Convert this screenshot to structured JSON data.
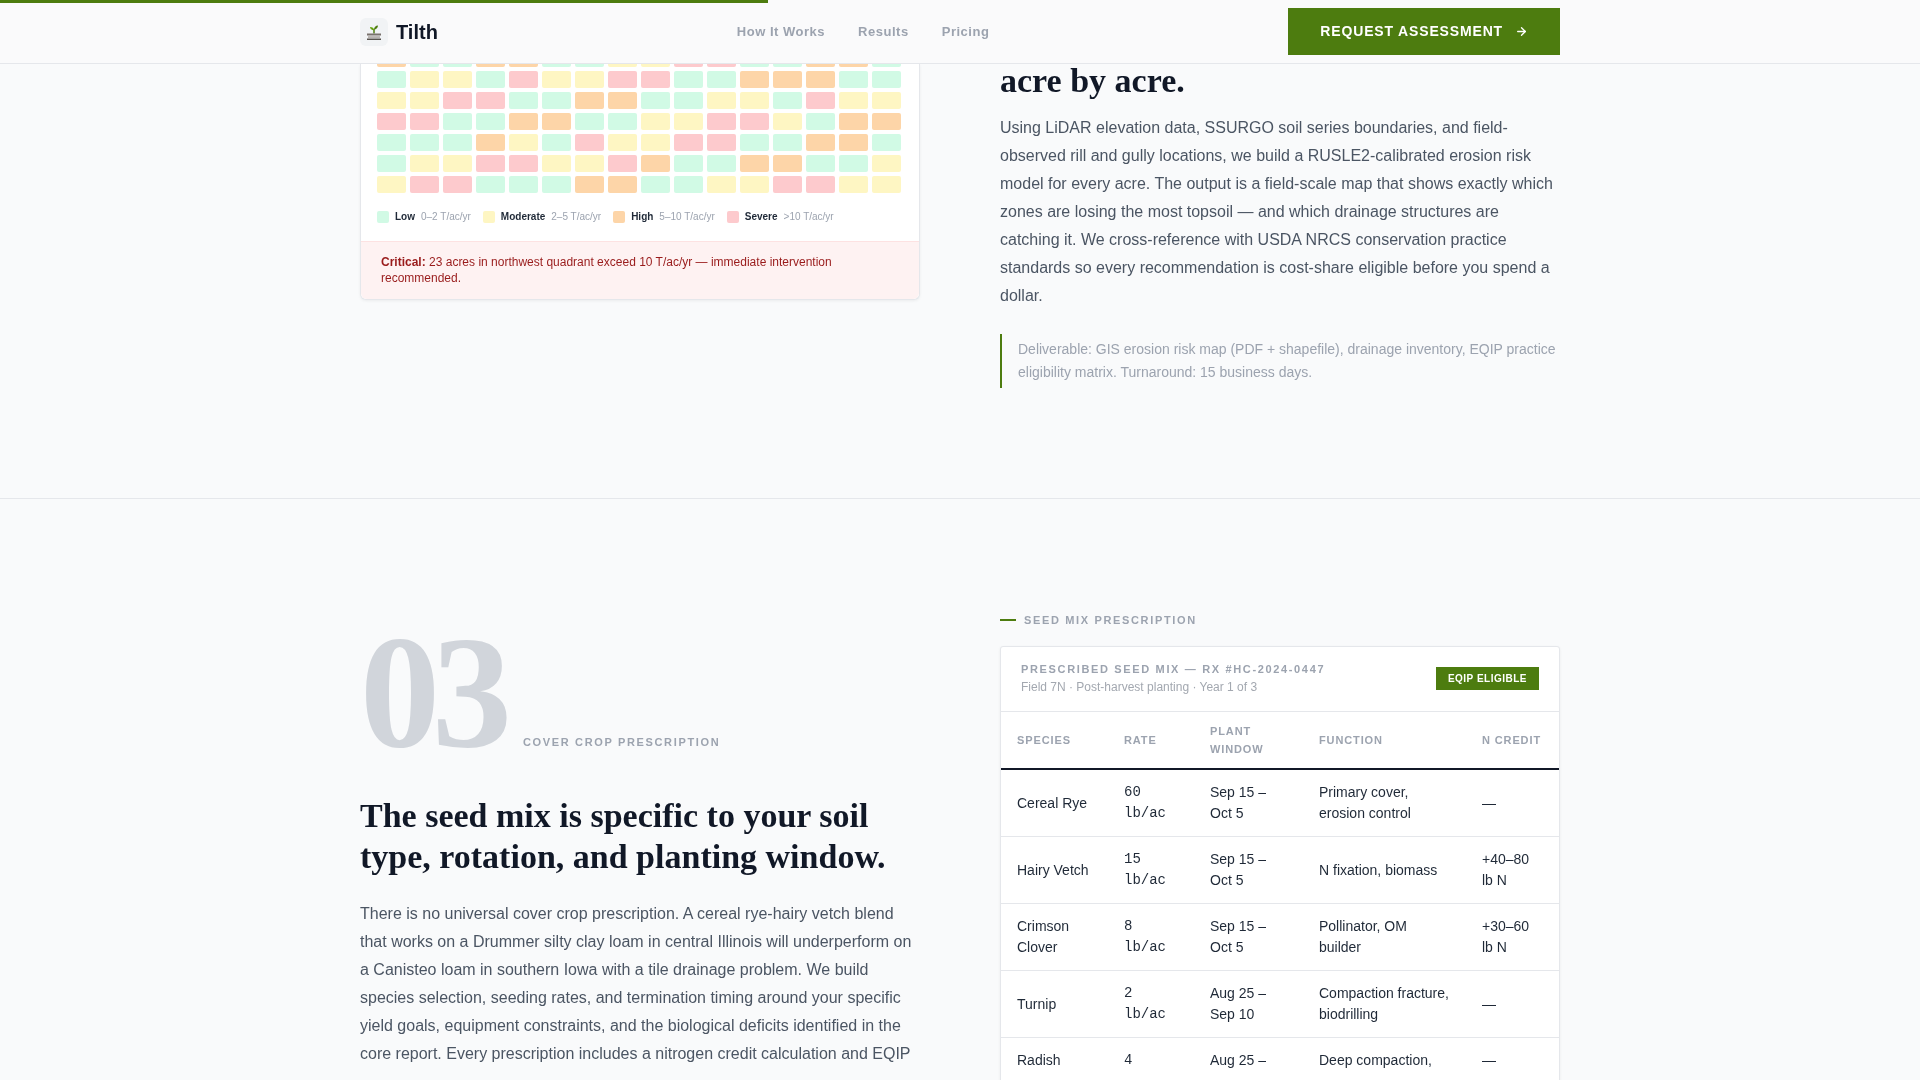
{
  "progress_bar": {
    "level": 0.4
  },
  "header": {
    "brand": "Tilth",
    "nav": [
      {
        "label": "How It Works"
      },
      {
        "label": "Results"
      },
      {
        "label": "Pricing"
      }
    ],
    "cta": "REQUEST ASSESSMENT"
  },
  "erosion_section": {
    "risk_map": {
      "clipped_row": [
        {
          "color": "#fdd5a8"
        },
        {
          "color": "#d1fae5"
        },
        {
          "color": "#d1fae5"
        },
        {
          "color": "#fdd5a8"
        },
        {
          "color": "#fdd5a8"
        },
        {
          "color": "#d1fae5"
        },
        {
          "color": "#d1fae5"
        },
        {
          "color": "#fef6c3"
        },
        {
          "color": "#fef6c3"
        },
        {
          "color": "#fdcacd"
        },
        {
          "color": "#fdcacd"
        },
        {
          "color": "#d1fae5"
        },
        {
          "color": "#d1fae5"
        },
        {
          "color": "#fdd5a8"
        },
        {
          "color": "#fdd5a8"
        },
        {
          "color": "#d1fae5"
        }
      ],
      "rows": [
        [
          {
            "color": "#d1fae5"
          },
          {
            "color": "#fef6c3"
          },
          {
            "color": "#fef6c3"
          },
          {
            "color": "#d1fae5"
          },
          {
            "color": "#fdcacd"
          },
          {
            "color": "#fef6c3"
          },
          {
            "color": "#fef6c3"
          },
          {
            "color": "#fdcacd"
          },
          {
            "color": "#fdcacd"
          },
          {
            "color": "#d1fae5"
          },
          {
            "color": "#d1fae5"
          },
          {
            "color": "#fdd5a8"
          },
          {
            "color": "#fdd5a8"
          },
          {
            "color": "#fdd5a8"
          },
          {
            "color": "#d1fae5"
          },
          {
            "color": "#d1fae5"
          }
        ],
        [
          {
            "color": "#fef6c3"
          },
          {
            "color": "#fef6c3"
          },
          {
            "color": "#fdcacd"
          },
          {
            "color": "#fdcacd"
          },
          {
            "color": "#d1fae5"
          },
          {
            "color": "#d1fae5"
          },
          {
            "color": "#fdd5a8"
          },
          {
            "color": "#fdd5a8"
          },
          {
            "color": "#d1fae5"
          },
          {
            "color": "#d1fae5"
          },
          {
            "color": "#fef6c3"
          },
          {
            "color": "#fef6c3"
          },
          {
            "color": "#d1fae5"
          },
          {
            "color": "#fdcacd"
          },
          {
            "color": "#fef6c3"
          },
          {
            "color": "#fef6c3"
          }
        ],
        [
          {
            "color": "#fdcacd"
          },
          {
            "color": "#fdcacd"
          },
          {
            "color": "#d1fae5"
          },
          {
            "color": "#d1fae5"
          },
          {
            "color": "#fdd5a8"
          },
          {
            "color": "#fdd5a8"
          },
          {
            "color": "#d1fae5"
          },
          {
            "color": "#d1fae5"
          },
          {
            "color": "#fef6c3"
          },
          {
            "color": "#fef6c3"
          },
          {
            "color": "#fdcacd"
          },
          {
            "color": "#fdcacd"
          },
          {
            "color": "#fef6c3"
          },
          {
            "color": "#d1fae5"
          },
          {
            "color": "#fdd5a8"
          },
          {
            "color": "#fdd5a8"
          }
        ],
        [
          {
            "color": "#d1fae5"
          },
          {
            "color": "#d1fae5"
          },
          {
            "color": "#d1fae5"
          },
          {
            "color": "#fdd5a8"
          },
          {
            "color": "#fef6c3"
          },
          {
            "color": "#d1fae5"
          },
          {
            "color": "#fdcacd"
          },
          {
            "color": "#fef6c3"
          },
          {
            "color": "#fef6c3"
          },
          {
            "color": "#fdcacd"
          },
          {
            "color": "#fdcacd"
          },
          {
            "color": "#d1fae5"
          },
          {
            "color": "#d1fae5"
          },
          {
            "color": "#fdd5a8"
          },
          {
            "color": "#fdd5a8"
          },
          {
            "color": "#d1fae5"
          }
        ],
        [
          {
            "color": "#d1fae5"
          },
          {
            "color": "#fef6c3"
          },
          {
            "color": "#fef6c3"
          },
          {
            "color": "#fdcacd"
          },
          {
            "color": "#fdcacd"
          },
          {
            "color": "#fef6c3"
          },
          {
            "color": "#fef6c3"
          },
          {
            "color": "#fdcacd"
          },
          {
            "color": "#fdd5a8"
          },
          {
            "color": "#d1fae5"
          },
          {
            "color": "#d1fae5"
          },
          {
            "color": "#fdd5a8"
          },
          {
            "color": "#fdd5a8"
          },
          {
            "color": "#d1fae5"
          },
          {
            "color": "#d1fae5"
          },
          {
            "color": "#fef6c3"
          }
        ],
        [
          {
            "color": "#fef6c3"
          },
          {
            "color": "#fdcacd"
          },
          {
            "color": "#fdcacd"
          },
          {
            "color": "#d1fae5"
          },
          {
            "color": "#d1fae5"
          },
          {
            "color": "#d1fae5"
          },
          {
            "color": "#fdd5a8"
          },
          {
            "color": "#fdd5a8"
          },
          {
            "color": "#d1fae5"
          },
          {
            "color": "#d1fae5"
          },
          {
            "color": "#fef6c3"
          },
          {
            "color": "#fef6c3"
          },
          {
            "color": "#fdcacd"
          },
          {
            "color": "#fdcacd"
          },
          {
            "color": "#fef6c3"
          },
          {
            "color": "#fef6c3"
          }
        ]
      ],
      "legend": [
        {
          "label": "Low",
          "range": "0–2 T/ac/yr",
          "color": "#d1fae5"
        },
        {
          "label": "Moderate",
          "range": "2–5 T/ac/yr",
          "color": "#fef6c3"
        },
        {
          "label": "High",
          "range": "5–10 T/ac/yr",
          "color": "#fdd5a8"
        },
        {
          "label": "Severe",
          "range": ">10 T/ac/yr",
          "color": "#fdcacd"
        }
      ],
      "alert": "**Critical:** 23 acres in northwest quadrant exceed 10 T/ac/yr — immediate intervention recommended."
    },
    "heading": "acre by acre.",
    "body": "Using LiDAR elevation data, SSURGO soil series boundaries, and field-observed rill and gully locations, we build a RUSLE2-calibrated erosion risk model for every acre. The output is a field-scale map that shows exactly which zones are losing the most topsoil — and which drainage structures are catching it. We cross-reference with USDA NRCS conservation practice standards so every recommendation is cost-share eligible before you spend a dollar.",
    "deliverable": "Deliverable: GIS erosion risk map (PDF + shapefile), drainage inventory, EQIP practice eligibility matrix. Turnaround: 15 business days."
  },
  "cover_crop_section": {
    "number": "03",
    "eyebrow": "COVER CROP PRESCRIPTION",
    "heading": "The seed mix is specific to your soil type, rotation, and planting window.",
    "body": "There is no universal cover crop prescription. A cereal rye-hairy vetch blend that works on a Drummer silty clay loam in central Illinois will underperform on a Canisteo loam in southern Iowa with a tile drainage problem. We build species selection, seeding rates, and termination timing around your specific yield goals, equipment constraints, and the biological deficits identified in the core report. Every prescription includes a nitrogen credit calculation and EQIP",
    "panel_label": "SEED MIX PRESCRIPTION",
    "prescription": {
      "title": "PRESCRIBED SEED MIX — RX #HC-2024-0447",
      "subtitle": "Field 7N · Post-harvest planting · Year 1 of 3",
      "badge": "EQIP ELIGIBLE",
      "columns": [
        "SPECIES",
        "RATE",
        "PLANT WINDOW",
        "FUNCTION",
        "N CREDIT"
      ],
      "rows": [
        {
          "species": "Cereal Rye",
          "rate": "60 lb/ac",
          "window": "Sep 15 – Oct 5",
          "function": "Primary cover, erosion control",
          "n_credit": "—"
        },
        {
          "species": "Hairy Vetch",
          "rate": "15 lb/ac",
          "window": "Sep 15 – Oct 5",
          "function": "N fixation, biomass",
          "n_credit": "+40–80 lb N"
        },
        {
          "species": "Crimson Clover",
          "rate": "8 lb/ac",
          "window": "Sep 15 – Oct 5",
          "function": "Pollinator, OM builder",
          "n_credit": "+30–60 lb N"
        },
        {
          "species": "Turnip",
          "rate": "2 lb/ac",
          "window": "Aug 25 – Sep 10",
          "function": "Compaction fracture, biodrilling",
          "n_credit": "—"
        },
        {
          "species": "Radish",
          "rate": "4",
          "window": "Aug 25 –",
          "function": "Deep compaction,",
          "n_credit": "—"
        }
      ]
    }
  }
}
